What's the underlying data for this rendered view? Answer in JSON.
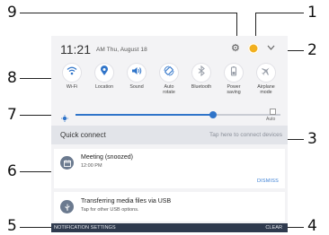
{
  "callouts": [
    "1",
    "2",
    "3",
    "4",
    "5",
    "6",
    "7",
    "8",
    "9"
  ],
  "status": {
    "time": "11:21",
    "date": "AM Thu, August 18"
  },
  "quick_settings": [
    {
      "label": "Wi-Fi",
      "icon": "wifi-icon"
    },
    {
      "label": "Location",
      "icon": "location-icon"
    },
    {
      "label": "Sound",
      "icon": "sound-icon"
    },
    {
      "label": "Auto\nrotate",
      "icon": "auto-rotate-icon"
    },
    {
      "label": "Bluetooth",
      "icon": "bluetooth-icon"
    },
    {
      "label": "Power\nsaving",
      "icon": "power-saving-icon"
    },
    {
      "label": "Airplane\nmode",
      "icon": "airplane-icon"
    }
  ],
  "brightness": {
    "level": 0.67,
    "auto_label": "Auto"
  },
  "quick_connect": {
    "title": "Quick connect",
    "hint": "Tap here to connect devices"
  },
  "notifications": [
    {
      "title": "Meeting (snoozed)",
      "subtitle": "12:00 PM",
      "action": "DISMISS"
    },
    {
      "title": "Transferring media files via USB",
      "subtitle": "Tap for other USB options."
    }
  ],
  "bottom_bar": {
    "settings": "NOTIFICATION SETTINGS",
    "clear": "CLEAR"
  },
  "colors": {
    "accent": "#2f74c9",
    "bottom_bar": "#2f3a4e",
    "avatar": "#f2b01e"
  }
}
